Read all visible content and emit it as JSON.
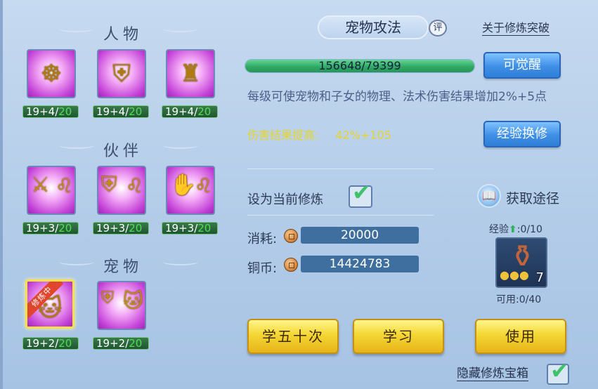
{
  "sections": {
    "people": {
      "title": "人物",
      "skills": [
        {
          "level": "19+4/",
          "max": "20"
        },
        {
          "level": "19+4/",
          "max": "20"
        },
        {
          "level": "19+4/",
          "max": "20"
        }
      ]
    },
    "partners": {
      "title": "伙伴",
      "skills": [
        {
          "level": "19+3/",
          "max": "20"
        },
        {
          "level": "19+3/",
          "max": "20"
        },
        {
          "level": "19+3/",
          "max": "20"
        }
      ]
    },
    "pets": {
      "title": "宠物",
      "skills": [
        {
          "level": "19+2/",
          "max": "20",
          "ribbon": "修炼中"
        },
        {
          "level": "19+2/",
          "max": "20"
        }
      ]
    }
  },
  "detail": {
    "title": "宠物攻法",
    "rate_badge": "评",
    "breakthrough_link": "关于修炼突破",
    "progress_text": "156648/79399",
    "progress_fraction": 1.0,
    "awaken_button": "可觉醒",
    "description": "每级可使宠物和子女的物理、法术伤害结果增加2%+5点",
    "effect_label": "伤害结果提高:",
    "effect_value": "42%+105",
    "exchange_button": "经验换修",
    "set_current_label": "设为当前修炼",
    "obtain_link": "获取途径",
    "cost_label": "消耗:",
    "cost_value": "20000",
    "coins_label": "铜币:",
    "coins_value": "14424783",
    "exp_label": "经验",
    "exp_value": ":0/10",
    "item_count": "7",
    "available_label": "可用:0/40",
    "btn_learn_50": "学五十次",
    "btn_learn": "学习",
    "btn_use": "使用",
    "hide_chest_label": "隐藏修炼宝箱"
  },
  "colors": {
    "accent_green": "#4be04e",
    "effect_yellow": "#e7d42c",
    "button_gold": "#f4d634",
    "button_blue": "#3f8fe6"
  }
}
